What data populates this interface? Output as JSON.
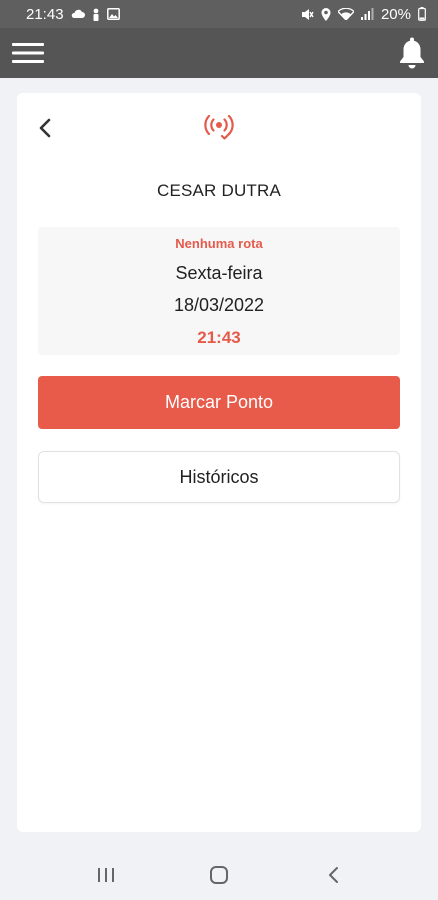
{
  "status_bar": {
    "time": "21:43",
    "battery": "20%",
    "left_icons": [
      "cloud-icon",
      "person-icon",
      "image-icon"
    ],
    "right_icons": [
      "mute-icon",
      "location-icon",
      "wifi-icon",
      "signal-icon",
      "battery-icon"
    ]
  },
  "app_bar": {
    "menu_icon": "hamburger-menu-icon",
    "notification_icon": "bell-icon",
    "background": "#555555"
  },
  "card": {
    "back_icon": "chevron-left-icon",
    "brand_icon": "broadcast-location-icon",
    "employee_name": "CESAR DUTRA",
    "route_status": "Nenhuma rota",
    "weekday": "Sexta-feira",
    "date": "18/03/2022",
    "time": "21:43",
    "primary_button": "Marcar Ponto",
    "secondary_button": "Históricos"
  },
  "colors": {
    "accent": "#e85b4b",
    "accent_text": "#e55a4a"
  },
  "nav_bar": {
    "icons": [
      "recent-apps-icon",
      "home-icon",
      "back-icon"
    ]
  }
}
